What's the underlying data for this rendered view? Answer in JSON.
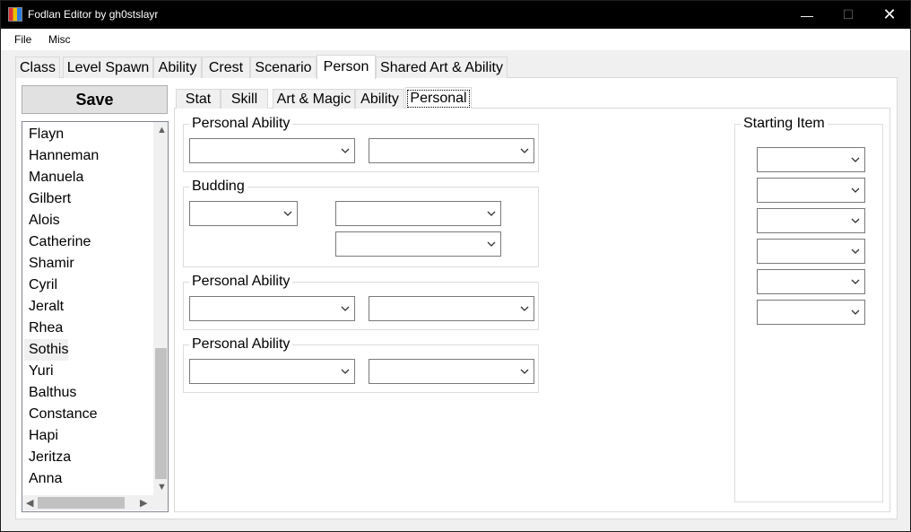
{
  "window": {
    "title": "Fodlan Editor by gh0stslayr",
    "min": "—",
    "max": "☐",
    "close": "✕"
  },
  "menu": [
    "File",
    "Misc"
  ],
  "main_tabs": [
    "Class",
    "Level Spawn",
    "Ability",
    "Crest",
    "Scenario",
    "Person",
    "Shared Art & Ability"
  ],
  "main_tab_active": "Person",
  "save_label": "Save",
  "person_list": [
    "Flayn",
    "Hanneman",
    "Manuela",
    "Gilbert",
    "Alois",
    "Catherine",
    "Shamir",
    "Cyril",
    "Jeralt",
    "Rhea",
    "Sothis",
    "Yuri",
    "Balthus",
    "Constance",
    "Hapi",
    "Jeritza",
    "Anna"
  ],
  "person_selected": "Sothis",
  "sub_tabs": [
    "Stat",
    "Skill",
    "Art & Magic",
    "Ability",
    "Personal"
  ],
  "sub_tab_active": "Personal",
  "groups": {
    "personal_ability_1": "Personal Ability",
    "budding": "Budding",
    "personal_ability_2": "Personal Ability",
    "personal_ability_3": "Personal Ability",
    "starting_item": "Starting Item"
  },
  "scroll_arrows": {
    "up": "▲",
    "down": "▼",
    "left": "◀",
    "right": "▶"
  }
}
